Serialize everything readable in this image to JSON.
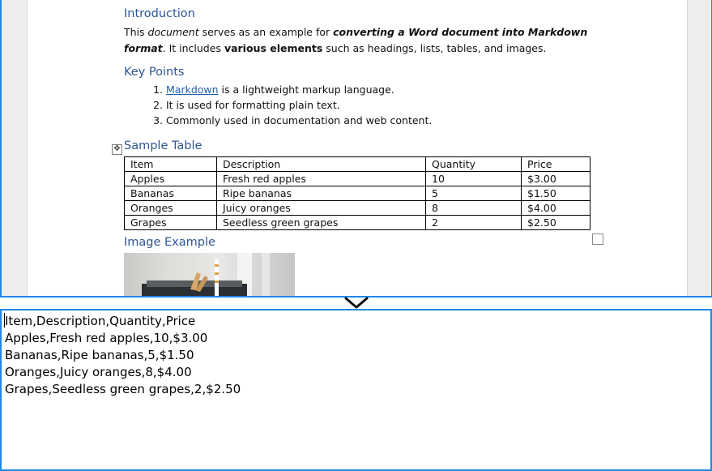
{
  "document": {
    "intro_heading": "Introduction",
    "intro_paragraph": [
      {
        "text": "This ",
        "style": "normal"
      },
      {
        "text": "document",
        "style": "italic"
      },
      {
        "text": " serves as an example for ",
        "style": "normal"
      },
      {
        "text": "converting a Word document into Markdown format",
        "style": "bolditalic"
      },
      {
        "text": ". It includes ",
        "style": "normal"
      },
      {
        "text": "various elements",
        "style": "bold"
      },
      {
        "text": " such as headings, lists, tables, and images.",
        "style": "normal"
      }
    ],
    "key_points_heading": "Key Points",
    "key_points": [
      {
        "num": "1.",
        "link": "Markdown",
        "text": " is a lightweight markup language."
      },
      {
        "num": "2.",
        "link": "",
        "text": "It is used for formatting plain text."
      },
      {
        "num": "3.",
        "link": "",
        "text": "Commonly used in documentation and web content."
      }
    ],
    "table_heading": "Sample Table",
    "table": {
      "headers": [
        "Item",
        "Description",
        "Quantity",
        "Price"
      ],
      "rows": [
        [
          "Apples",
          "Fresh red apples",
          "10",
          "$3.00"
        ],
        [
          "Bananas",
          "Ripe bananas",
          "5",
          "$1.50"
        ],
        [
          "Oranges",
          "Juicy oranges",
          "8",
          "$4.00"
        ],
        [
          "Grapes",
          "Seedless green grapes",
          "2",
          "$2.50"
        ]
      ]
    },
    "image_heading": "Image Example"
  },
  "csv_output": {
    "lines": [
      "Item,Description,Quantity,Price",
      "Apples,Fresh red apples,10,$3.00",
      "Bananas,Ripe bananas,5,$1.50",
      "Oranges,Juicy oranges,8,$4.00",
      "Grapes,Seedless green grapes,2,$2.50"
    ]
  },
  "icons": {
    "table_move_handle": "move-arrows-icon",
    "splitter": "chevron-down-icon"
  },
  "colors": {
    "accent_border": "#1e88e5",
    "heading": "#2f5496",
    "link": "#1f5fa8"
  }
}
